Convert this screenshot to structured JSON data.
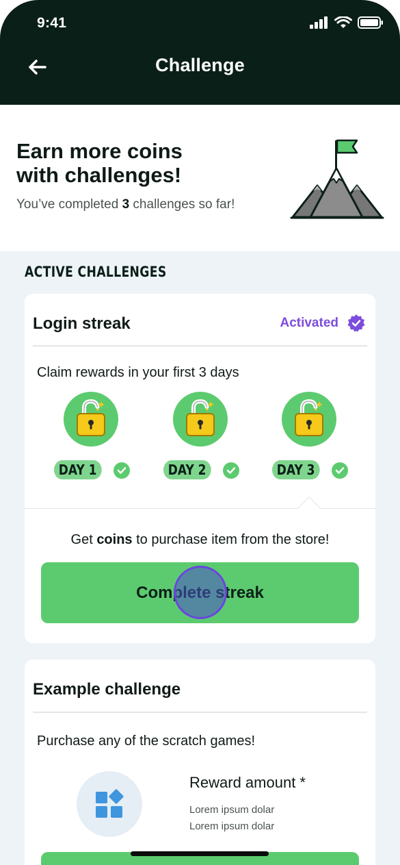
{
  "status_bar": {
    "time": "9:41"
  },
  "header": {
    "title": "Challenge"
  },
  "hero": {
    "title_line1": "Earn more coins",
    "title_line2": "with challenges!",
    "subtitle_prefix": "You’ve completed ",
    "completed_count": "3",
    "subtitle_suffix": " challenges so far!"
  },
  "section": {
    "label": "ACTIVE CHALLENGES"
  },
  "login_streak": {
    "title": "Login streak",
    "status": "Activated",
    "description": "Claim rewards in your first 3 days",
    "days": [
      {
        "label": "DAY 1",
        "completed": true
      },
      {
        "label": "DAY 2",
        "completed": true
      },
      {
        "label": "DAY 3",
        "completed": true
      }
    ],
    "info_prefix": "Get ",
    "info_bold": "coins",
    "info_suffix": " to purchase item from the store!",
    "button_label": "Complete streak"
  },
  "example_challenge": {
    "title": "Example challenge",
    "description": "Purchase any of the scratch games!",
    "reward_title": "Reward amount *",
    "reward_line1": "Lorem ipsum dolar",
    "reward_line2": "Lorem ipsum dolar"
  },
  "icons": {
    "back": "arrow-left-icon",
    "signal": "cellular-signal-icon",
    "wifi": "wifi-icon",
    "battery": "battery-icon",
    "hero": "mountain-flag-icon",
    "status": "verified-badge-icon",
    "lock": "unlocked-padlock-icon",
    "check": "check-circle-icon",
    "reward": "apps-grid-icon"
  },
  "colors": {
    "header_bg": "#0b1f19",
    "accent_green": "#5ccb6f",
    "activated_purple": "#7c4ddd",
    "page_bg": "#eef3f7"
  }
}
